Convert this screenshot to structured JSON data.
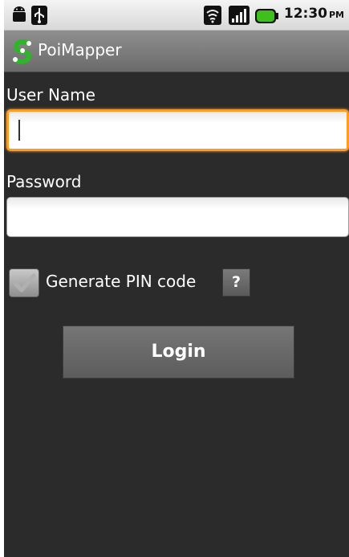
{
  "status_bar": {
    "time": "12:30",
    "ampm": "PM",
    "icons": [
      "android-icon",
      "usb-icon",
      "wifi-icon",
      "signal-icon",
      "battery-icon"
    ],
    "battery_color": "#3fbf1a"
  },
  "title_bar": {
    "app_name": "PoiMapper",
    "logo_icon": "poimapper-logo-icon",
    "logo_color": "#2fb52a"
  },
  "form": {
    "username": {
      "label": "User Name",
      "value": "",
      "focused": true
    },
    "password": {
      "label": "Password",
      "value": ""
    },
    "pin": {
      "label": "Generate PIN code",
      "checked": false,
      "help_label": "?"
    },
    "login_label": "Login"
  },
  "colors": {
    "focus_border": "#ff9b1e",
    "background": "#2b2b2b"
  }
}
